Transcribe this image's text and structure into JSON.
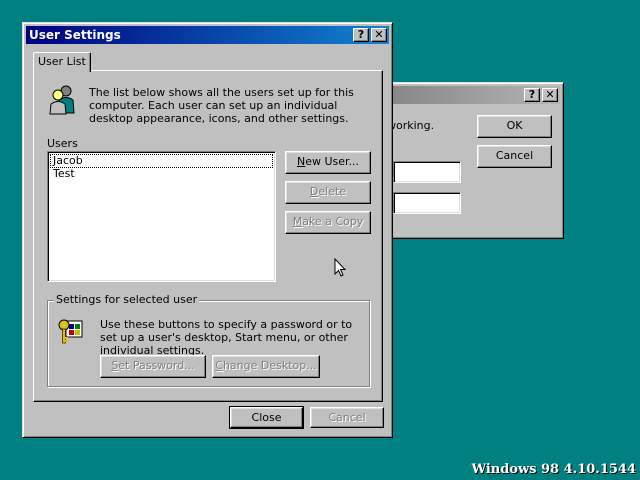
{
  "background_color": "#008080",
  "back_dialog": {
    "help_button": "?",
    "close_button": "✕",
    "message": "working.",
    "ok_label": "OK",
    "cancel_label": "Cancel"
  },
  "dialog": {
    "title": "User Settings",
    "help_button": "?",
    "close_button": "✕",
    "tab_label": "User List",
    "description": "The list below shows all the users set up for this computer. Each user can set up an individual desktop appearance, icons, and other settings.",
    "users_label": "Users",
    "users": [
      "Jacob",
      "Test"
    ],
    "selected_user": "Jacob",
    "new_user_prefix": "",
    "new_user_underlined": "N",
    "new_user_rest": "ew User...",
    "delete_prefix": "",
    "delete_underlined": "D",
    "delete_rest": "elete",
    "copy_prefix": "",
    "copy_underlined": "M",
    "copy_rest": "ake a Copy",
    "group_label": "Settings for selected user",
    "group_text": "Use these buttons to specify a password or to set up a user's desktop, Start menu, or other individual settings.",
    "set_password_prefix": "",
    "set_password_underlined": "S",
    "set_password_rest": "et Password...",
    "change_desktop_prefix": "",
    "change_desktop_underlined": "C",
    "change_desktop_rest": "hange Desktop...",
    "close_label": "Close",
    "cancel_label": "Cancel"
  },
  "icons": {
    "users_icon": "users-icon",
    "keys_icon": "keys-icon",
    "cursor": "mouse-cursor-icon"
  },
  "version_text": "Windows 98 4.10.1544"
}
